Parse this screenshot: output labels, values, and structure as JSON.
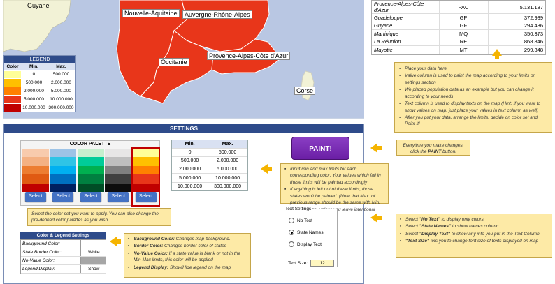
{
  "map": {
    "guyane_label": "Guyane",
    "regions": {
      "nouvelle_aquitaine": "Nouvelle-Aquitaine",
      "auvergne": "Auvergne-Rhône-Alpes",
      "provence": "Provence-Alpes-Côte d'Azur",
      "occitanie": "Occitanie",
      "corse": "Corse"
    },
    "fill_color": "#e8361a",
    "sea_color": "#b9c7e3",
    "land_color": "#f2f2d6"
  },
  "legend": {
    "title": "LEGEND",
    "headers": {
      "color": "Color",
      "min": "Min.",
      "max": "Max."
    },
    "rows": [
      {
        "color": "#ffff99",
        "min": "0",
        "max": "500.000"
      },
      {
        "color": "#ffc000",
        "min": "500.000",
        "max": "2.000.000"
      },
      {
        "color": "#ff8000",
        "min": "2.000.000",
        "max": "5.000.000"
      },
      {
        "color": "#e8361a",
        "min": "5.000.000",
        "max": "10.000.000"
      },
      {
        "color": "#c00000",
        "min": "10.000.000",
        "max": "300.000.000"
      }
    ]
  },
  "data_table": {
    "rows": [
      {
        "name": "Provence-Alpes-Côte d'Azur",
        "code": "PAC",
        "value": "5.131.187"
      },
      {
        "name": "Guadeloupe",
        "code": "GP",
        "value": "372.939"
      },
      {
        "name": "Guyane",
        "code": "GF",
        "value": "294.436"
      },
      {
        "name": "Martinique",
        "code": "MQ",
        "value": "350.373"
      },
      {
        "name": "La Réunion",
        "code": "RE",
        "value": "868.846"
      },
      {
        "name": "Mayotte",
        "code": "MT",
        "value": "299.348"
      }
    ]
  },
  "notes": {
    "data_note": [
      "Place your data here",
      "Value column is used to paint the map according to your limits on settings section",
      "We placed population data as an example but you can change it according to your needs",
      "Text column is used to display texts on the map (Hint: If you want to show values on map, just place your values in text column as well)",
      "After you put your data, arrange the limits, decide on color set and Paint it!"
    ],
    "paint_note_1": "Everytime you make changes,",
    "paint_note_2": "click the",
    "paint_note_bold": "PAINT",
    "paint_note_3": "button!",
    "limits_note": [
      "Input min and max limits for each corresponding color. Your values which fall in these limits will be painted accordingly",
      "If anything is left out of these limits, those states won't be painted. (Note that Max. of previous range should be the same with Min. of next range, unless you leave intentional gaps)"
    ],
    "palette_note": "Select the color set you want to apply. You can also change the pre-defined color palettes as you wish.",
    "color_settings_note": [
      {
        "bold": "Background Color:",
        "text": " Changes map background."
      },
      {
        "bold": "Border Color:",
        "text": " Changes border color of states"
      },
      {
        "bold": "No-Value Color:",
        "text": " If a state value is blank or not in the Min-Max limits, this color will be applied"
      },
      {
        "bold": "Legend Display:",
        "text": " Show/Hide legend on the map"
      }
    ],
    "text_note": [
      {
        "pre": "Select ",
        "bold": "\"No Text\"",
        "text": " to display only colors"
      },
      {
        "pre": "Select ",
        "bold": "\"State Names\"",
        "text": " to show names column"
      },
      {
        "pre": "Select ",
        "bold": "\"Display Text\"",
        "text": " to show any info you put in the Text Column."
      },
      {
        "pre": "",
        "bold": "\"Text Size\"",
        "text": " lets you to change font size of texts displayed on map"
      }
    ]
  },
  "settings": {
    "title": "SETTINGS",
    "palette": {
      "title": "COLOR PALETTE",
      "button_label": "Select",
      "columns": [
        [
          "#f8cbad",
          "#f4b183",
          "#ed7d31",
          "#e05a12",
          "#c00000"
        ],
        [
          "#9dc3e6",
          "#2ec4e6",
          "#00b0f0",
          "#0070c0",
          "#002060"
        ],
        [
          "#c6efce",
          "#00cc99",
          "#00b050",
          "#008040",
          "#004d26"
        ],
        [
          "#e7e6e6",
          "#bfbfbf",
          "#808080",
          "#404040",
          "#0d0d0d"
        ],
        [
          "#ffff99",
          "#ffc000",
          "#ff8000",
          "#e8361a",
          "#c00000"
        ]
      ]
    },
    "limits": {
      "headers": {
        "min": "Min.",
        "max": "Max."
      },
      "rows": [
        {
          "min": "0",
          "max": "500.000"
        },
        {
          "min": "500.000",
          "max": "2.000.000"
        },
        {
          "min": "2.000.000",
          "max": "5.000.000"
        },
        {
          "min": "5.000.000",
          "max": "10.000.000"
        },
        {
          "min": "10.000.000",
          "max": "300.000.000"
        }
      ]
    },
    "paint_button": "PAINT!",
    "color_legend": {
      "title": "Color & Legend Settings",
      "rows": [
        {
          "label": "Background Color:",
          "value": "",
          "swatch": "#ffffff"
        },
        {
          "label": "State Border Color:",
          "value": "White",
          "swatch": "#ffffff"
        },
        {
          "label": "No-Value Color:",
          "value": "",
          "swatch": "#a6a6a6"
        },
        {
          "label": "Legend Display:",
          "value": "Show",
          "swatch": "#ffffff"
        }
      ]
    },
    "text_settings": {
      "title": "Text Settings",
      "options": [
        "No Text",
        "State Names",
        "Display Text"
      ],
      "selected_index": 1,
      "size_label": "Text Size:",
      "size_value": "12"
    }
  }
}
